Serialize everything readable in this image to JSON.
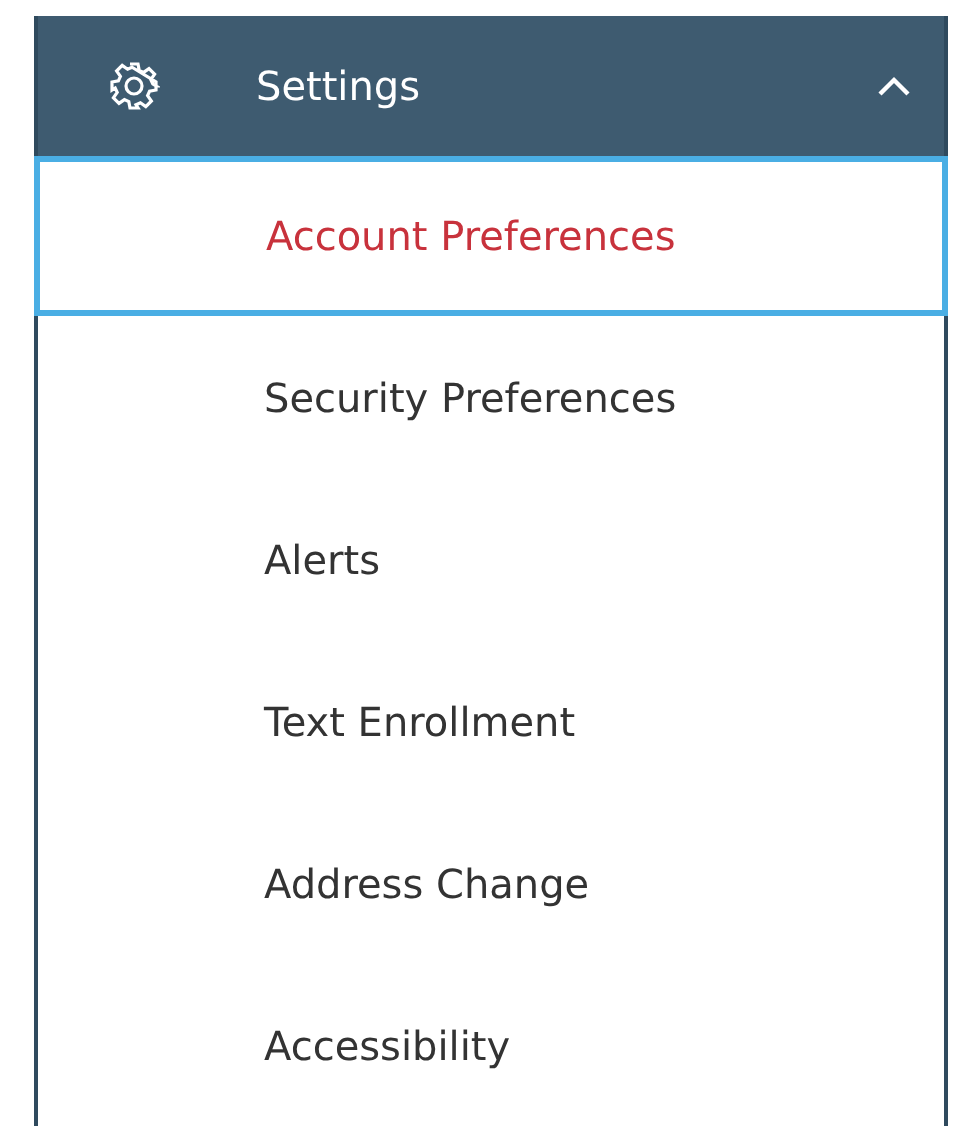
{
  "header": {
    "title": "Settings",
    "expanded": true
  },
  "items": [
    {
      "label": "Account Preferences",
      "selected": true
    },
    {
      "label": "Security Preferences",
      "selected": false
    },
    {
      "label": "Alerts",
      "selected": false
    },
    {
      "label": "Text Enrollment",
      "selected": false
    },
    {
      "label": "Address Change",
      "selected": false
    },
    {
      "label": "Accessibility",
      "selected": false
    }
  ]
}
